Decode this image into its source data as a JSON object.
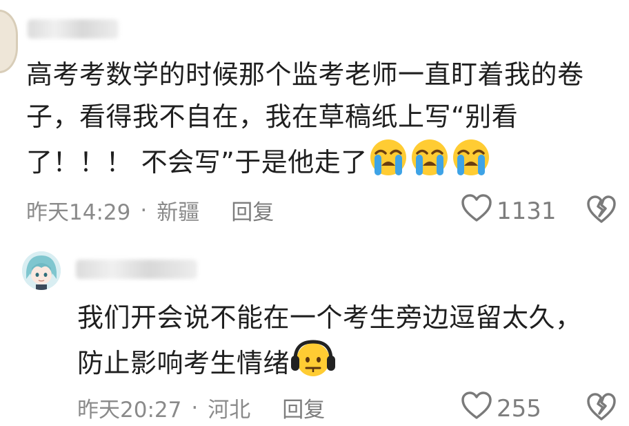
{
  "comment1": {
    "content_line1": "高考考数学的时候那个监考老师一直盯着我的卷",
    "content_line2": "子，看得我不自在，我在草稿纸上写“别看",
    "content_line3": "了！！！ 不会写”于是他走了",
    "emojis": [
      "crying-face",
      "crying-face",
      "crying-face"
    ],
    "time": "昨天14:29",
    "separator": "·",
    "location": "新疆",
    "reply_label": "回复",
    "like_count": "1131"
  },
  "comment2": {
    "content_line1": "我们开会说不能在一个考生旁边逗留太久，",
    "content_line2": "防止影响考生情绪",
    "emojis": [
      "headphones-face"
    ],
    "time": "昨天20:27",
    "separator": "·",
    "location": "河北",
    "reply_label": "回复",
    "like_count": "255"
  },
  "colors": {
    "text": "#1f1f1f",
    "meta": "#8a8a8a",
    "emoji_yellow": "#ffcc33",
    "tear_blue": "#3ea3e6"
  }
}
